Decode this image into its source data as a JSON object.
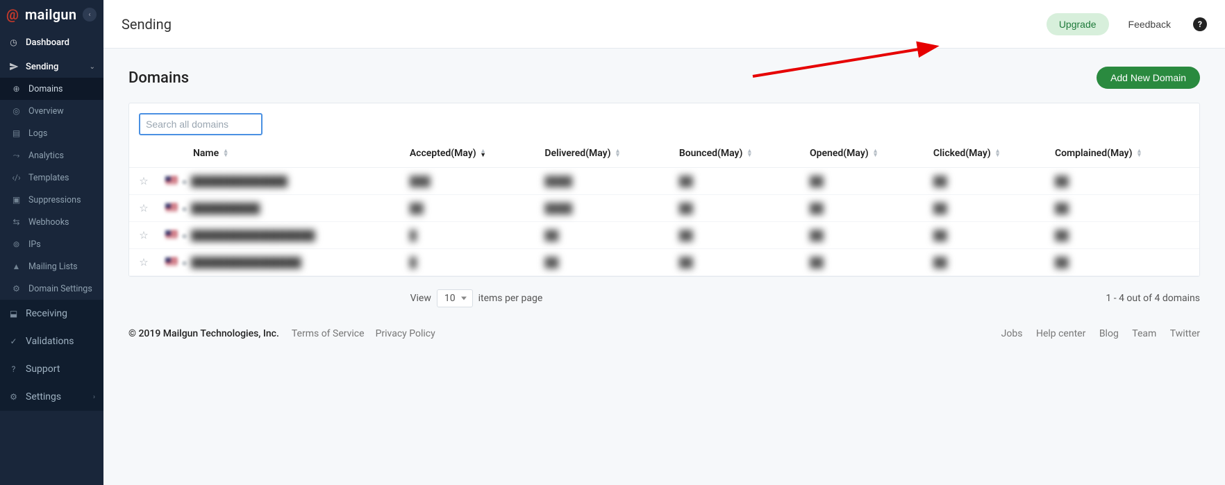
{
  "brand": {
    "logo_text": "mailgun"
  },
  "sidebar": {
    "collapse_tip": "Collapse",
    "items": [
      {
        "icon": "gauge-icon",
        "label": "Dashboard"
      },
      {
        "icon": "send-icon",
        "label": "Sending",
        "expandable": true
      },
      {
        "icon": "globe-icon",
        "label": "Domains",
        "sub": true,
        "active": true
      },
      {
        "icon": "eye-icon",
        "label": "Overview",
        "sub": true
      },
      {
        "icon": "doc-icon",
        "label": "Logs",
        "sub": true
      },
      {
        "icon": "chart-icon",
        "label": "Analytics",
        "sub": true
      },
      {
        "icon": "code-icon",
        "label": "Templates",
        "sub": true
      },
      {
        "icon": "stop-icon",
        "label": "Suppressions",
        "sub": true
      },
      {
        "icon": "share-icon",
        "label": "Webhooks",
        "sub": true
      },
      {
        "icon": "ip-icon",
        "label": "IPs",
        "sub": true
      },
      {
        "icon": "user-icon",
        "label": "Mailing Lists",
        "sub": true
      },
      {
        "icon": "gear-icon",
        "label": "Domain Settings",
        "sub": true
      },
      {
        "icon": "inbox-icon",
        "label": "Receiving",
        "dark": true
      },
      {
        "icon": "check-icon",
        "label": "Validations",
        "dark": true
      },
      {
        "icon": "help-icon",
        "label": "Support",
        "dark": true
      },
      {
        "icon": "gear-icon",
        "label": "Settings",
        "dark": true,
        "expandable": true
      }
    ]
  },
  "topbar": {
    "title": "Sending",
    "upgrade": "Upgrade",
    "feedback": "Feedback"
  },
  "page": {
    "heading": "Domains",
    "add_button": "Add New Domain",
    "search_placeholder": "Search all domains"
  },
  "table": {
    "columns": [
      {
        "key": "name",
        "label": "Name"
      },
      {
        "key": "accepted",
        "label": "Accepted(May)",
        "sorted": "desc"
      },
      {
        "key": "delivered",
        "label": "Delivered(May)"
      },
      {
        "key": "bounced",
        "label": "Bounced(May)"
      },
      {
        "key": "opened",
        "label": "Opened(May)"
      },
      {
        "key": "clicked",
        "label": "Clicked(May)"
      },
      {
        "key": "complained",
        "label": "Complained(May)"
      }
    ],
    "rows": [
      {
        "name": "██████████████",
        "accepted": "███",
        "delivered": "████",
        "bounced": "██",
        "opened": "██",
        "clicked": "██",
        "complained": "██"
      },
      {
        "name": "██████████",
        "accepted": "██",
        "delivered": "████",
        "bounced": "██",
        "opened": "██",
        "clicked": "██",
        "complained": "██"
      },
      {
        "name": "██████████████████",
        "accepted": "█",
        "delivered": "██",
        "bounced": "██",
        "opened": "██",
        "clicked": "██",
        "complained": "██"
      },
      {
        "name": "████████████████",
        "accepted": "█",
        "delivered": "██",
        "bounced": "██",
        "opened": "██",
        "clicked": "██",
        "complained": "██"
      }
    ]
  },
  "pager": {
    "view_label": "View",
    "per_page_value": "10",
    "per_page_suffix": "items per page",
    "summary": "1 - 4 out of 4 domains"
  },
  "footer": {
    "copyright": "© 2019 Mailgun Technologies, Inc.",
    "left_links": [
      "Terms of Service",
      "Privacy Policy"
    ],
    "right_links": [
      "Jobs",
      "Help center",
      "Blog",
      "Team",
      "Twitter"
    ]
  }
}
